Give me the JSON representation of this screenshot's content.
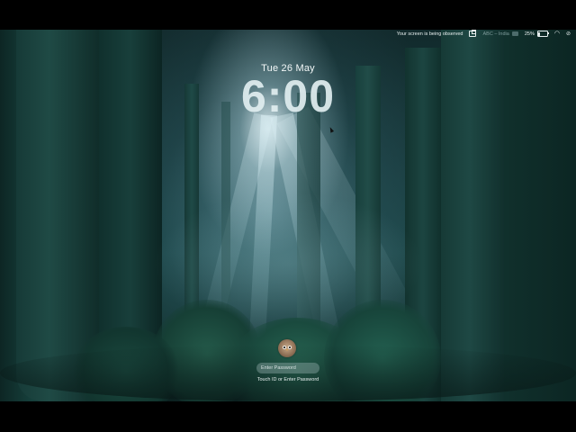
{
  "menubar": {
    "screen_observed": "Your screen is being observed",
    "input_source": "ABC – India",
    "battery_percent": "25%",
    "battery_level": 0.25,
    "icons": [
      "screen-sharing-icon",
      "input-flag-icon",
      "battery-icon",
      "wifi-icon",
      "control-center-icon"
    ]
  },
  "lockscreen": {
    "date": "Tue 26 May",
    "time": "6:00",
    "password_placeholder": "Enter Password",
    "hint": "Touch ID or Enter Password",
    "avatar_icon": "owl-avatar-icon"
  },
  "colors": {
    "forest_dark": "#0a1f1e",
    "forest_mid": "#1a4445",
    "light_glow": "#e6f5fa",
    "text": "#f2f7f7"
  }
}
